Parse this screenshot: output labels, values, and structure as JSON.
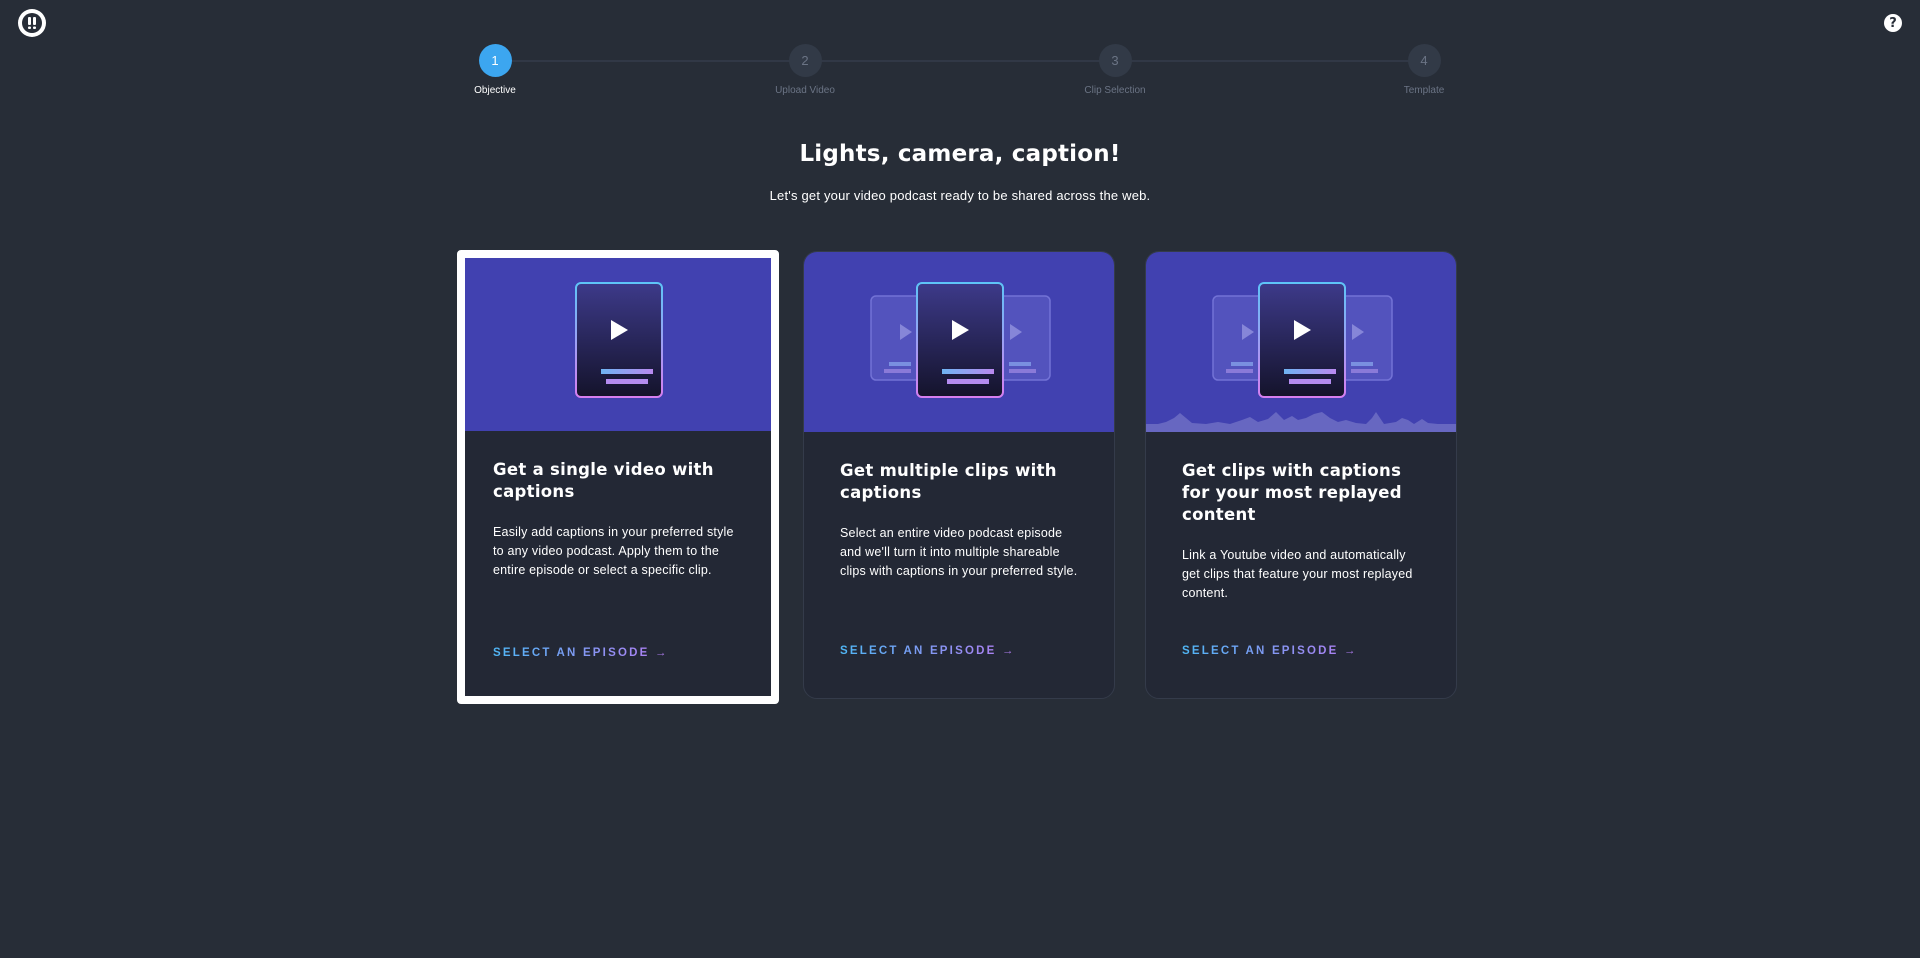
{
  "header": {
    "logo_icon": "app-logo-icon",
    "help_icon": "help-icon",
    "help_glyph": "?"
  },
  "stepper": {
    "steps": [
      {
        "number": "1",
        "label": "Objective",
        "active": true
      },
      {
        "number": "2",
        "label": "Upload Video",
        "active": false
      },
      {
        "number": "3",
        "label": "Clip Selection",
        "active": false
      },
      {
        "number": "4",
        "label": "Template",
        "active": false
      }
    ]
  },
  "main": {
    "title": "Lights, camera, caption!",
    "subtitle": "Let's get your video podcast ready to be shared across the web."
  },
  "cards": [
    {
      "title": "Get a single video with captions",
      "description": "Easily add captions in your preferred style to any video podcast. Apply them to the entire episode or select a specific clip.",
      "cta": "SELECT AN EPISODE →",
      "selected": true,
      "illustration": "single-video-illustration"
    },
    {
      "title": "Get multiple clips with captions",
      "description": "Select an entire video podcast episode and we'll turn it into multiple shareable clips with captions in your preferred style.",
      "cta": "SELECT AN EPISODE →",
      "selected": false,
      "illustration": "multiple-clips-illustration"
    },
    {
      "title": "Get clips with captions for your most replayed content",
      "description": "Link a Youtube video and automatically get clips that feature your most replayed content.",
      "cta": "SELECT AN EPISODE →",
      "selected": false,
      "illustration": "replayed-clips-illustration"
    }
  ],
  "colors": {
    "background": "#272d37",
    "card_background": "#232835",
    "hero_background": "#4141b0",
    "active_step": "#3ca6f0",
    "cta_gradient_start": "#4fb7f6",
    "cta_gradient_end": "#b57bf2"
  }
}
